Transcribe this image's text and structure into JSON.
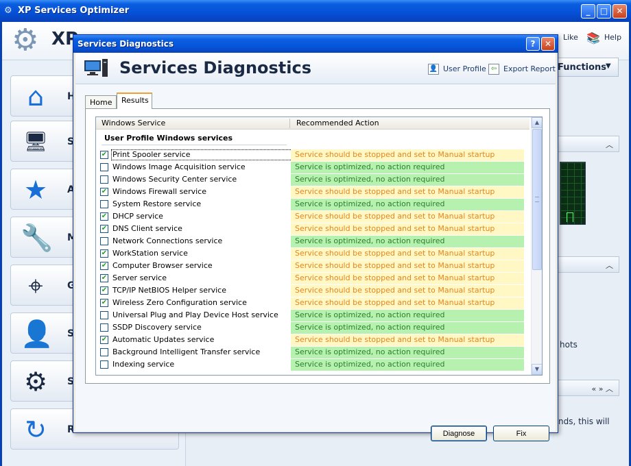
{
  "app": {
    "title": "XP Services Optimizer",
    "brand": "XP",
    "top_like": "Like",
    "top_help": "Help",
    "functions_label": "Functions",
    "bg_hots": "hots",
    "bg_nds": "nds, this will"
  },
  "sidebar": {
    "items": [
      {
        "label": "H",
        "icon": "home-icon"
      },
      {
        "label": "Se",
        "icon": "computer-icon"
      },
      {
        "label": "A",
        "icon": "star-icon"
      },
      {
        "label": "M",
        "icon": "wrench-icon"
      },
      {
        "label": "G",
        "icon": "crosshair-icon"
      },
      {
        "label": "S",
        "icon": "user-icon"
      },
      {
        "label": "S",
        "icon": "gears-icon"
      },
      {
        "label": "R",
        "icon": "refresh-icon"
      }
    ]
  },
  "dialog": {
    "title": "Services Diagnostics",
    "header_title": "Services Diagnostics",
    "user_profile": "User Profile",
    "export_report": "Export Report",
    "tabs": [
      "Home",
      "Results"
    ],
    "active_tab": "Results",
    "columns": [
      "Windows Service",
      "Recommended Action"
    ],
    "group": "User Profile Windows services",
    "rows": [
      {
        "checked": true,
        "service": "Print Spooler service",
        "action": "Service should be stopped and set to Manual startup",
        "status": "stop"
      },
      {
        "checked": false,
        "service": "Windows Image Acquisition service",
        "action": "Service is optimized, no action required",
        "status": "ok"
      },
      {
        "checked": false,
        "service": "Windows Security Center service",
        "action": "Service is optimized, no action required",
        "status": "ok"
      },
      {
        "checked": true,
        "service": "Windows Firewall service",
        "action": "Service should be stopped and set to Manual startup",
        "status": "stop"
      },
      {
        "checked": false,
        "service": "System Restore service",
        "action": "Service is optimized, no action required",
        "status": "ok"
      },
      {
        "checked": true,
        "service": "DHCP service",
        "action": "Service should be stopped and set to Manual startup",
        "status": "stop"
      },
      {
        "checked": true,
        "service": "DNS Client service",
        "action": "Service should be stopped and set to Manual startup",
        "status": "stop"
      },
      {
        "checked": false,
        "service": "Network Connections service",
        "action": "Service is optimized, no action required",
        "status": "ok"
      },
      {
        "checked": true,
        "service": "WorkStation service",
        "action": "Service should be stopped and set to Manual startup",
        "status": "stop"
      },
      {
        "checked": true,
        "service": "Computer Browser service",
        "action": "Service should be stopped and set to Manual startup",
        "status": "stop"
      },
      {
        "checked": true,
        "service": "Server service",
        "action": "Service should be stopped and set to Manual startup",
        "status": "stop"
      },
      {
        "checked": true,
        "service": "TCP/IP NetBIOS Helper service",
        "action": "Service should be stopped and set to Manual startup",
        "status": "stop"
      },
      {
        "checked": true,
        "service": "Wireless Zero Configuration service",
        "action": "Service should be stopped and set to Manual startup",
        "status": "stop"
      },
      {
        "checked": false,
        "service": "Universal Plug and Play Device Host service",
        "action": "Service is optimized, no action required",
        "status": "ok"
      },
      {
        "checked": false,
        "service": "SSDP Discovery service",
        "action": "Service is optimized, no action required",
        "status": "ok"
      },
      {
        "checked": true,
        "service": "Automatic Updates service",
        "action": "Service should be stopped and set to Manual startup",
        "status": "stop"
      },
      {
        "checked": false,
        "service": "Background Intelligent Transfer service",
        "action": "Service is optimized, no action required",
        "status": "ok"
      },
      {
        "checked": false,
        "service": "Indexing service",
        "action": "Service is optimized, no action required",
        "status": "ok"
      }
    ],
    "diagnose_label": "Diagnose",
    "fix_label": "Fix"
  },
  "colors": {
    "stop_bg": "#fff7c4",
    "stop_text": "#e8841a",
    "ok_bg": "#b6f1b0",
    "ok_text": "#2a7f2a",
    "titlebar": "#0553d8"
  }
}
